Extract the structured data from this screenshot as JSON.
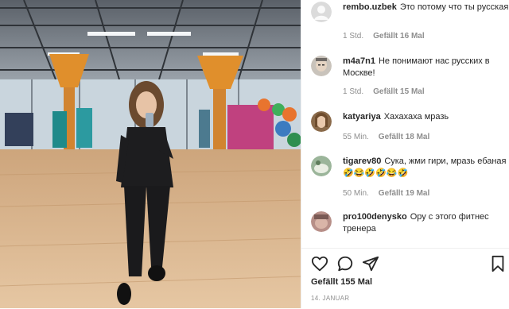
{
  "comments": [
    {
      "username": "rembo.uzbek",
      "text": "Это потому что ты русская",
      "time": "1 Std.",
      "likes": "Gefällt 16 Mal"
    },
    {
      "username": "m4a7n1",
      "text": "Не понимают нас русских в Москве!",
      "time": "1 Std.",
      "likes": "Gefällt 15 Mal"
    },
    {
      "username": "katyariya",
      "text": "Хахахаха мразь",
      "time": "55 Min.",
      "likes": "Gefällt 18 Mal"
    },
    {
      "username": "tigarev80",
      "text": "Сука, жми гири, мразь ебаная🤣😂🤣🤣😂🤣",
      "time": "50 Min.",
      "likes": "Gefällt 19 Mal"
    },
    {
      "username": "pro100denysko",
      "text": "Ору с этого фитнес тренера"
    }
  ],
  "post": {
    "likes": "Gefällt 155 Mal",
    "date": "14. JANUAR"
  },
  "icons": {
    "like": "heart-icon",
    "comment": "comment-icon",
    "share": "share-icon",
    "save": "bookmark-icon"
  },
  "colors": {
    "text": "#262626",
    "muted": "#8e8e8e",
    "floor": "#d3a878"
  }
}
